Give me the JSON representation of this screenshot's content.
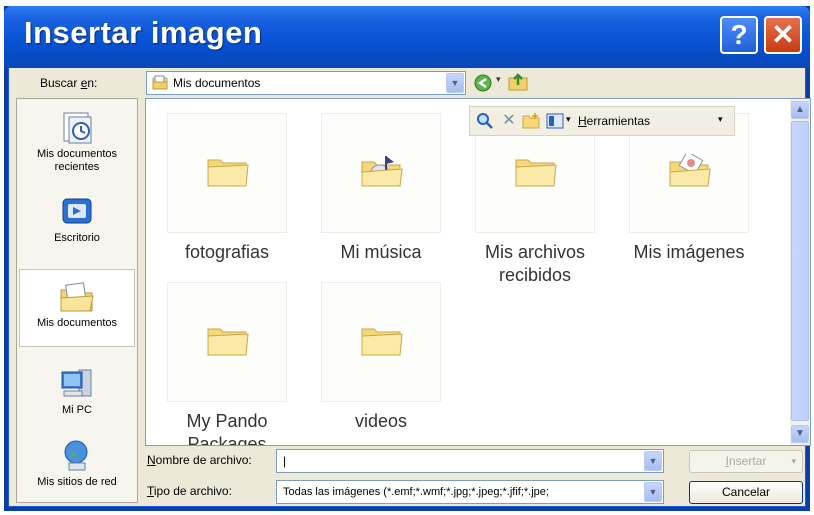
{
  "window": {
    "title": "Insertar imagen",
    "help_glyph": "?",
    "close_glyph": "✕"
  },
  "lookin": {
    "label_pre": "Buscar ",
    "label_accel": "e",
    "label_post": "n:",
    "value": "Mis documentos"
  },
  "floating_toolbar": {
    "tools_pre": "",
    "tools_accel": "H",
    "tools_post": "erramientas"
  },
  "places": [
    {
      "label": "Mis documentos recientes",
      "icon": "recent-documents-icon"
    },
    {
      "label": "Escritorio",
      "icon": "desktop-icon"
    },
    {
      "label": "Mis documentos",
      "icon": "my-documents-icon",
      "selected": true
    },
    {
      "label": "Mi PC",
      "icon": "my-computer-icon"
    },
    {
      "label": "Mis sitios de red",
      "icon": "network-places-icon"
    }
  ],
  "files": [
    {
      "label": "fotografias",
      "icon": "folder-icon"
    },
    {
      "label": "Mi música",
      "icon": "music-folder-icon"
    },
    {
      "label": "Mis archivos recibidos",
      "icon": "folder-icon"
    },
    {
      "label": "Mis imágenes",
      "icon": "pictures-folder-icon"
    },
    {
      "label": "My Pando Packages",
      "icon": "folder-icon"
    },
    {
      "label": "videos",
      "icon": "folder-icon"
    }
  ],
  "filename": {
    "label_accel": "N",
    "label_rest": "ombre de archivo:",
    "value": "|"
  },
  "filetype": {
    "label_accel": "T",
    "label_rest": "ipo de archivo:",
    "value": "Todas las imágenes (*.emf;*.wmf;*.jpg;*.jpeg;*.jfif;*.jpe;"
  },
  "buttons": {
    "insert_accel": "I",
    "insert_rest": "nsertar",
    "insert_arrow": "▾",
    "cancel": "Cancelar"
  },
  "colors": {
    "title_blue": "#0a55d8",
    "folder_yellow": "#f8e08a",
    "dialog_bg": "#ece9d8"
  }
}
